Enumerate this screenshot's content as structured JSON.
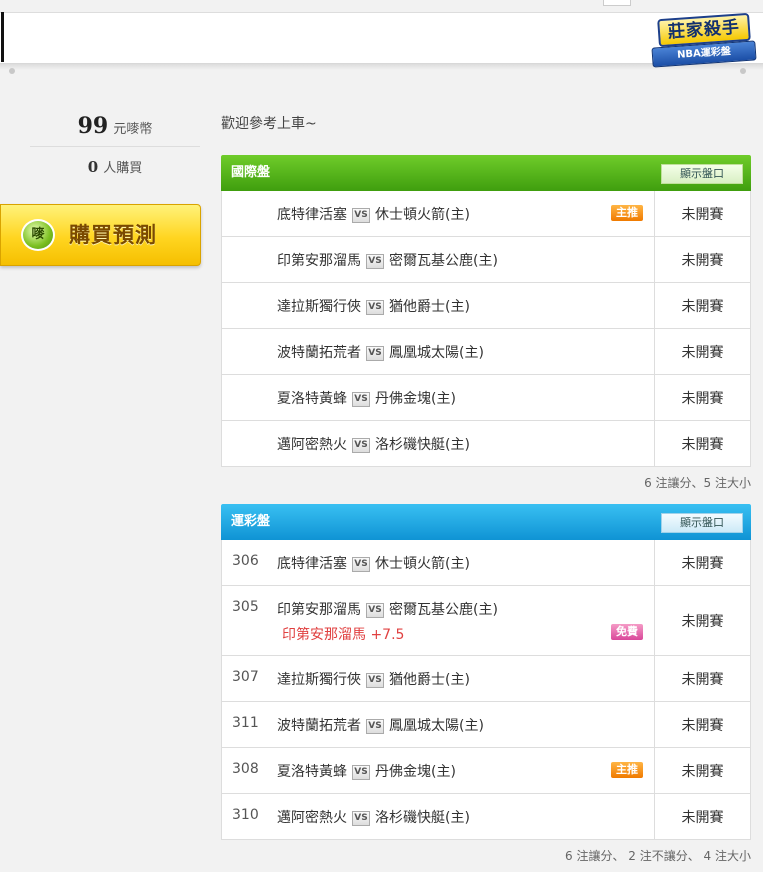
{
  "logo": {
    "main": "莊家殺手",
    "ribbon": "NBA運彩盤"
  },
  "sidebar": {
    "price_number": "99",
    "price_unit": "元嘜幣",
    "buyers_number": "0",
    "buyers_unit": "人購買",
    "buy_icon": "嘜",
    "buy_label": "購買預測"
  },
  "welcome": "歡迎參考上車~",
  "international": {
    "title": "國際盤",
    "show_button": "顯示盤口",
    "rows": [
      {
        "away": "底特律活塞",
        "home": "休士頓火箭(主)",
        "tag": "主推",
        "status": "未開賽"
      },
      {
        "away": "印第安那溜馬",
        "home": "密爾瓦基公鹿(主)",
        "tag": "",
        "status": "未開賽"
      },
      {
        "away": "達拉斯獨行俠",
        "home": "猶他爵士(主)",
        "tag": "",
        "status": "未開賽"
      },
      {
        "away": "波特蘭拓荒者",
        "home": "鳳凰城太陽(主)",
        "tag": "",
        "status": "未開賽"
      },
      {
        "away": "夏洛特黃蜂",
        "home": "丹佛金塊(主)",
        "tag": "",
        "status": "未開賽"
      },
      {
        "away": "邁阿密熱火",
        "home": "洛杉磯快艇(主)",
        "tag": "",
        "status": "未開賽"
      }
    ],
    "summary": "6 注讓分、5 注大小"
  },
  "sports_lottery": {
    "title": "運彩盤",
    "show_button": "顯示盤口",
    "rows": [
      {
        "code": "306",
        "away": "底特律活塞",
        "home": "休士頓火箭(主)",
        "tag": "",
        "pick": "",
        "status": "未開賽"
      },
      {
        "code": "305",
        "away": "印第安那溜馬",
        "home": "密爾瓦基公鹿(主)",
        "tag": "免費",
        "pick": "印第安那溜馬 +7.5",
        "status": "未開賽"
      },
      {
        "code": "307",
        "away": "達拉斯獨行俠",
        "home": "猶他爵士(主)",
        "tag": "",
        "pick": "",
        "status": "未開賽"
      },
      {
        "code": "311",
        "away": "波特蘭拓荒者",
        "home": "鳳凰城太陽(主)",
        "tag": "",
        "pick": "",
        "status": "未開賽"
      },
      {
        "code": "308",
        "away": "夏洛特黃蜂",
        "home": "丹佛金塊(主)",
        "tag": "主推",
        "pick": "",
        "status": "未開賽"
      },
      {
        "code": "310",
        "away": "邁阿密熱火",
        "home": "洛杉磯快艇(主)",
        "tag": "",
        "pick": "",
        "status": "未開賽"
      }
    ],
    "summary": "6 注讓分、 2 注不讓分、 4 注大小"
  },
  "vs_label": "VS",
  "colors": {
    "green_header": "#4fae17",
    "blue_header": "#1ea7e3",
    "tag_orange": "#f58a10",
    "tag_pink": "#e060a8",
    "pick_red": "#e04040",
    "buy_yellow": "#ffd520"
  }
}
